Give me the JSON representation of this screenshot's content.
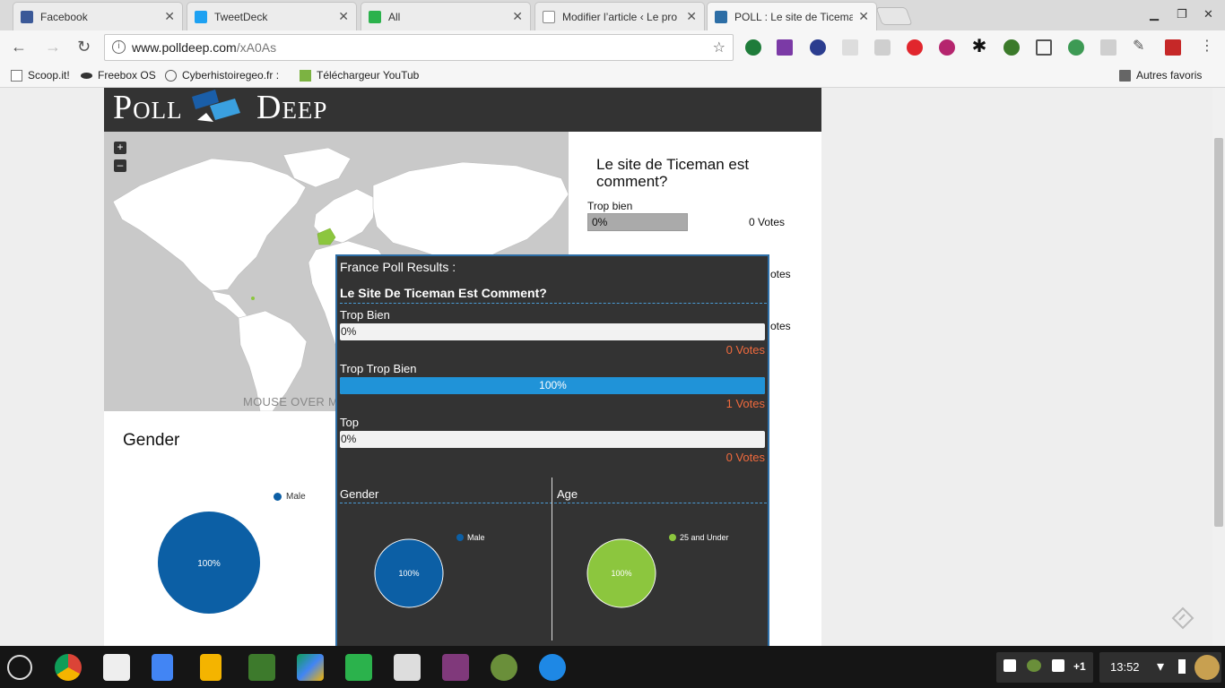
{
  "browser": {
    "tabs": [
      {
        "title": "Facebook",
        "color": "#3b5998"
      },
      {
        "title": "TweetDeck",
        "color": "#1da1f2"
      },
      {
        "title": "All",
        "color": "#2bb24c"
      },
      {
        "title": "Modifier l’article ‹ Le pro",
        "color": "#888888"
      },
      {
        "title": "POLL : Le site de Ticema",
        "color": "#2d6ea6"
      }
    ],
    "url_host": "www.polldeep.com",
    "url_path": "/xA0As",
    "bookmarks": [
      "Scoop.it!",
      "Freebox OS",
      "Cyberhistoiregeo.fr : ",
      "Téléchargeur YouTub",
      "Autres favoris"
    ]
  },
  "site": {
    "logo_left": "Poll",
    "logo_right": "Deep"
  },
  "map": {
    "zoom_in": "+",
    "zoom_out": "–",
    "hint": "MOUSE OVER M"
  },
  "poll": {
    "question": "Le site de Ticeman est comment?",
    "options": [
      {
        "label": "Trop bien",
        "percent": "0%",
        "votes": "0 Votes"
      },
      {
        "votes": "otes"
      },
      {
        "votes": "otes"
      }
    ]
  },
  "gender_chart": {
    "title": "Gender",
    "legend": "Male",
    "slice_label": "100%"
  },
  "popup": {
    "title": "France Poll Results :",
    "question": "Le Site De Ticeman Est Comment?",
    "options": [
      {
        "label": "Trop Bien",
        "percent": "0%",
        "votes": "0 Votes",
        "value": 0
      },
      {
        "label": "Trop Trop Bien",
        "percent": "100%",
        "votes": "1 Votes",
        "value": 100
      },
      {
        "label": "Top",
        "percent": "0%",
        "votes": "0 Votes",
        "value": 0
      }
    ],
    "gender": {
      "title": "Gender",
      "legend": "Male",
      "slice_label": "100%",
      "color": "#0c5fa5"
    },
    "age": {
      "title": "Age",
      "legend": "25 and Under",
      "slice_label": "100%",
      "color": "#8cc63e"
    }
  },
  "shelf": {
    "notif_count": "+1",
    "time": "13:52"
  },
  "colors": {
    "accent_blue": "#2093d8",
    "vote_orange": "#f06a3d",
    "male_blue": "#0c5fa5",
    "age_green": "#8cc63e",
    "france_green": "#8cc63e"
  }
}
